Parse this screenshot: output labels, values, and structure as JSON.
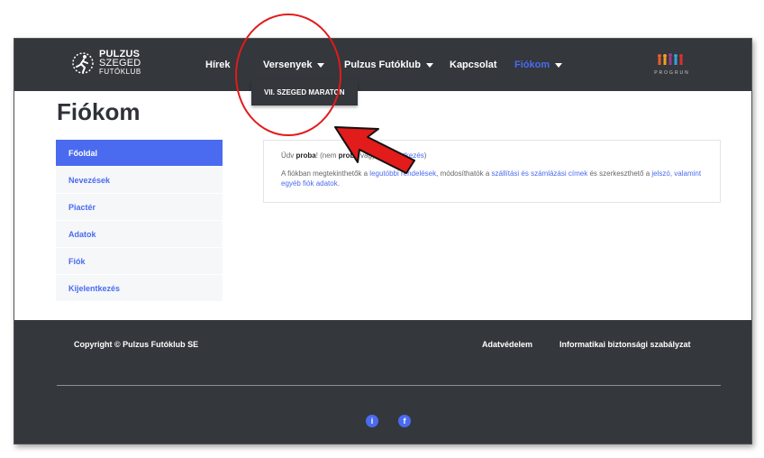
{
  "header": {
    "logo": {
      "line1": "PULZUS",
      "line2": "SZEGED",
      "line3": "FUTÓKLUB"
    },
    "nav": [
      {
        "label": "Hírek",
        "has_caret": false
      },
      {
        "label": "Versenyek",
        "has_caret": true
      },
      {
        "label": "Pulzus Futóklub",
        "has_caret": true
      },
      {
        "label": "Kapcsolat",
        "has_caret": false
      },
      {
        "label": "Fiókom",
        "has_caret": true,
        "active": true
      }
    ],
    "dropdown_item": "VII. SZEGED MARATON",
    "brand_right_text": "PROGRUN"
  },
  "page": {
    "title": "Fiókom"
  },
  "sidebar": {
    "items": [
      {
        "label": "Főoldal",
        "active": true
      },
      {
        "label": "Nevezések"
      },
      {
        "label": "Piactér"
      },
      {
        "label": "Adatok"
      },
      {
        "label": "Fiók"
      },
      {
        "label": "Kijelentkezés"
      }
    ]
  },
  "content": {
    "greeting_prefix": "Üdv ",
    "greeting_user": "proba",
    "greeting_middle": "! (nem ",
    "greeting_user2": "proba",
    "greeting_after": " vagy? ",
    "greeting_link": "Kijelentkezés",
    "greeting_end": ")",
    "desc_1": "A fiókban megtekinthetők a ",
    "desc_link1": "legutóbbi rendelések",
    "desc_2": ", módosíthatók a ",
    "desc_link2": "szállítási és számlázási címek",
    "desc_3": " és szerkeszthető a ",
    "desc_link3": "jelszó, valamint egyéb fiók adatok",
    "desc_4": "."
  },
  "footer": {
    "copyright": "Copyright © Pulzus Futóklub SE",
    "links": [
      "Adatvédelem",
      "Informatikai biztonsági szabályzat"
    ],
    "icons": [
      "info-icon",
      "facebook-icon"
    ]
  },
  "colors": {
    "accent": "#4a6bf0",
    "dark": "#34373c",
    "annotation": "#e21b1b"
  }
}
